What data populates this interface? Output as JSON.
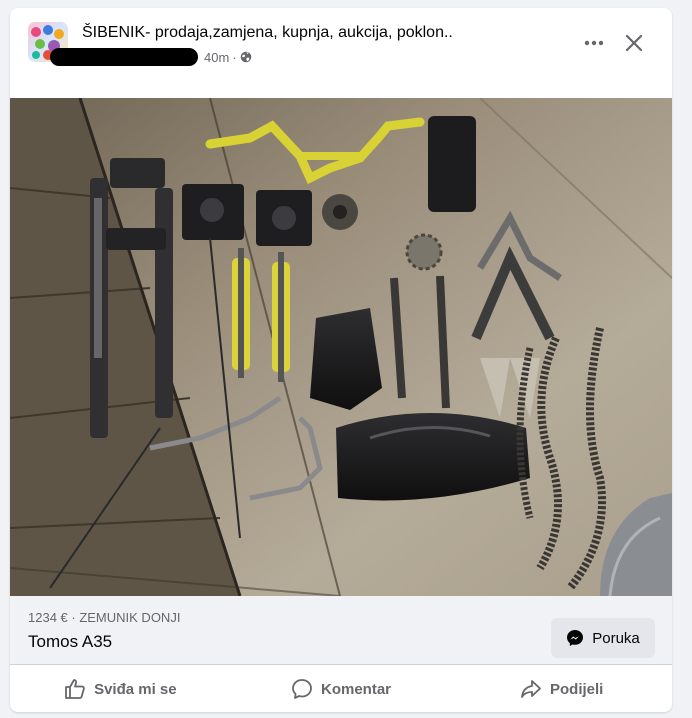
{
  "post": {
    "group_name": "ŠIBENIK- prodaja,zamjena, kupnja, aukcija, poklon..",
    "time": "40m",
    "separator": "·"
  },
  "photo": {
    "icon": "photo-of-motorcycle-parts"
  },
  "listing": {
    "price_location": "1234 € · ZEMUNIK DONJI",
    "title": "Tomos A35",
    "message_button": "Poruka"
  },
  "actions": {
    "like": "Sviđa mi se",
    "comment": "Komentar",
    "share": "Podijeli"
  },
  "colors": {
    "background": "#f0f2f5",
    "secondary_text": "#65676b",
    "button_bg": "#e4e6eb"
  }
}
